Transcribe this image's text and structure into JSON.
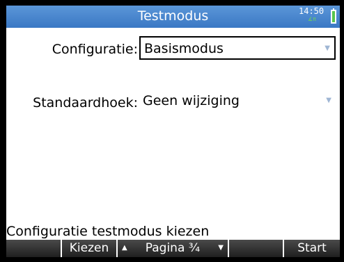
{
  "titlebar": {
    "title": "Testmodus",
    "time": "14:50",
    "angle_mode": "∡π"
  },
  "form": {
    "config_label": "Configuratie:",
    "config_value": "Basismodus",
    "angle_label": "Standaardhoek:",
    "angle_value": "Geen wijziging"
  },
  "hint": "Configuratie testmodus kiezen",
  "menu": {
    "key1": "",
    "key2": "Kiezen",
    "key3": "Pagina ³⁄₄",
    "key4": "",
    "key5": "Start"
  },
  "colors": {
    "titlebar": "#3a78c4",
    "battery": "#58c64c",
    "menu_bg": "#2b2b2b"
  }
}
